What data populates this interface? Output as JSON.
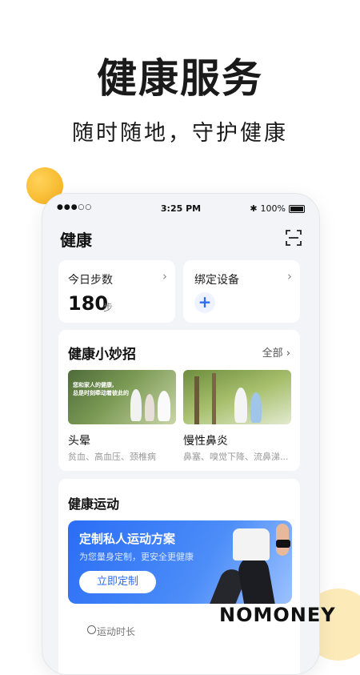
{
  "promo": {
    "headline": "健康服务",
    "subline": "随时随地，守护健康"
  },
  "status_bar": {
    "signal": "●●●○○",
    "time": "3:25 PM",
    "bluetooth": "✱",
    "battery": "100%"
  },
  "app": {
    "title": "健康",
    "scan_icon": "scan-icon"
  },
  "steps_card": {
    "title": "今日步数",
    "value": "180",
    "unit": "步",
    "chevron": "›"
  },
  "device_card": {
    "title": "绑定设备",
    "add": "+",
    "chevron": "›"
  },
  "tips": {
    "title": "健康小妙招",
    "all_label": "全部 ›",
    "items": [
      {
        "title": "头晕",
        "subtitle": "贫血、高血压、颈椎病",
        "overlay": [
          "您和家人的健康,",
          "总是时刻牵动着彼此的"
        ]
      },
      {
        "title": "慢性鼻炎",
        "subtitle": "鼻塞、嗅觉下降、流鼻涕..."
      }
    ]
  },
  "sport": {
    "title": "健康运动",
    "banner_title": "定制私人运动方案",
    "banner_sub": "为您量身定制，更安全更健康",
    "banner_button": "立即定制",
    "stat_label": "运动时长"
  },
  "watermark": {
    "brand": "NOMONEY",
    "colors": {
      "accent": "#2a6df5",
      "gold": "#f4ae17"
    }
  }
}
